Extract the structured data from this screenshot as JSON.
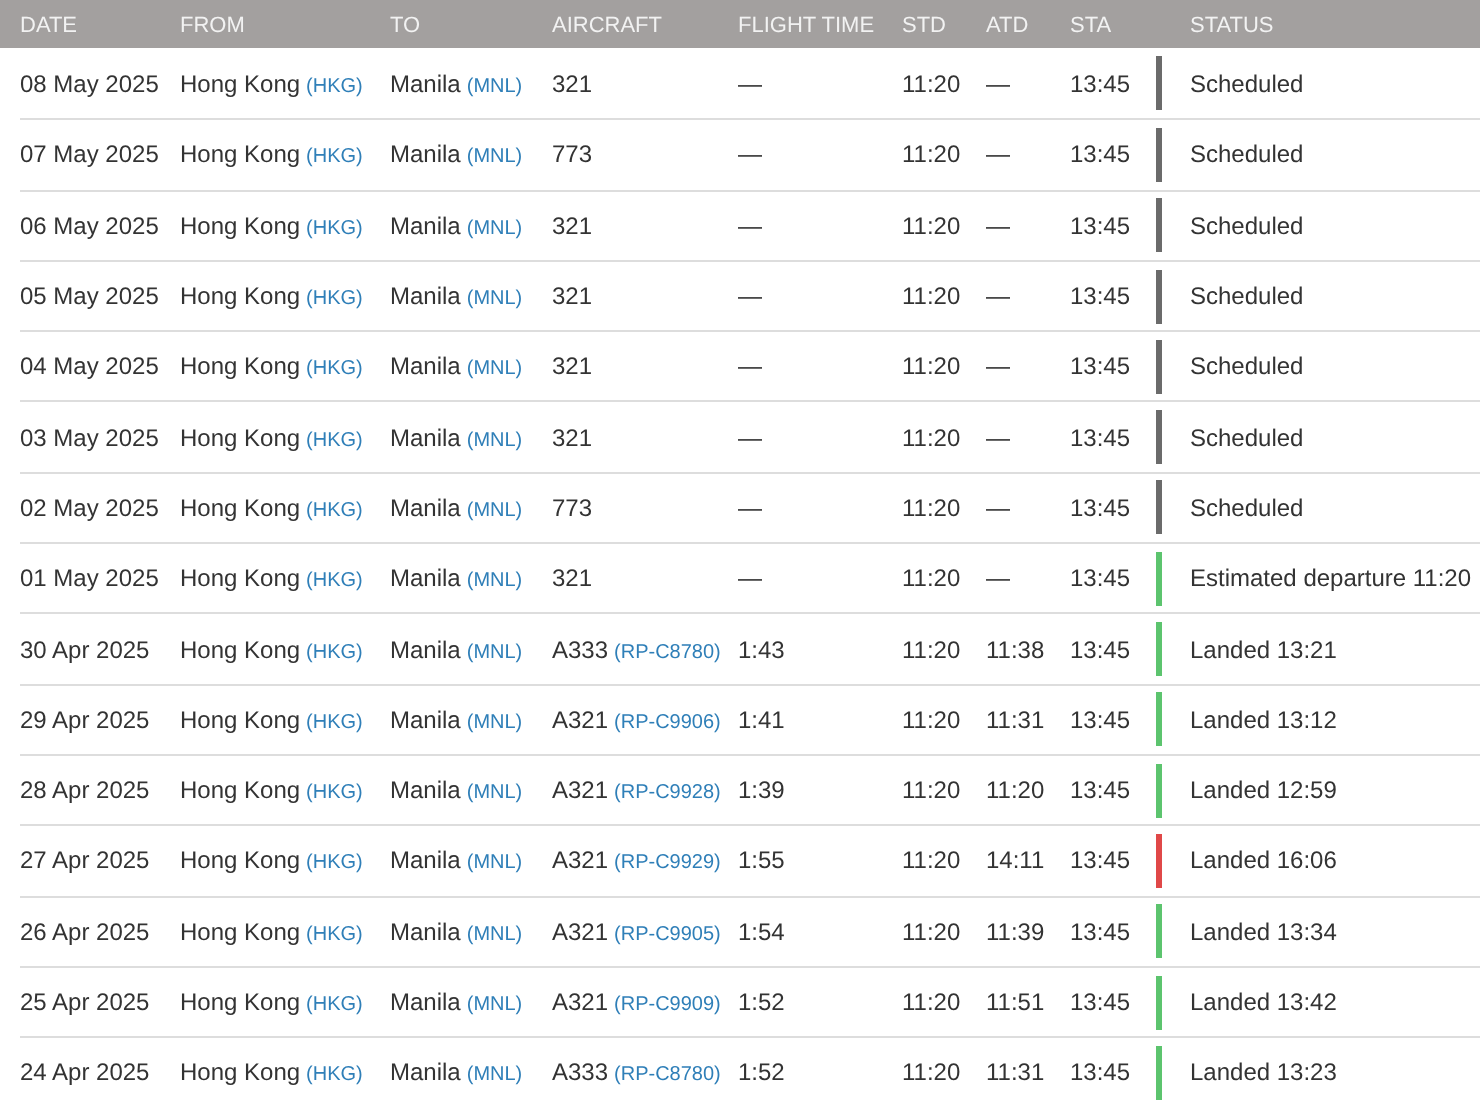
{
  "columns": [
    "DATE",
    "FROM",
    "TO",
    "AIRCRAFT",
    "FLIGHT TIME",
    "STD",
    "ATD",
    "STA",
    "STATUS"
  ],
  "rows": [
    {
      "date": "08 May 2025",
      "from": "Hong Kong",
      "from_code": "(HKG)",
      "to": "Manila",
      "to_code": "(MNL)",
      "aircraft": "321",
      "flight_time": "—",
      "std": "11:20",
      "atd": "—",
      "sta": "13:45",
      "status": "Scheduled",
      "color": "#6b6b6b"
    },
    {
      "date": "07 May 2025",
      "from": "Hong Kong",
      "from_code": "(HKG)",
      "to": "Manila",
      "to_code": "(MNL)",
      "aircraft": "773",
      "flight_time": "—",
      "std": "11:20",
      "atd": "—",
      "sta": "13:45",
      "status": "Scheduled",
      "color": "#6b6b6b"
    },
    {
      "date": "06 May 2025",
      "from": "Hong Kong",
      "from_code": "(HKG)",
      "to": "Manila",
      "to_code": "(MNL)",
      "aircraft": "321",
      "flight_time": "—",
      "std": "11:20",
      "atd": "—",
      "sta": "13:45",
      "status": "Scheduled",
      "color": "#6b6b6b"
    },
    {
      "date": "05 May 2025",
      "from": "Hong Kong",
      "from_code": "(HKG)",
      "to": "Manila",
      "to_code": "(MNL)",
      "aircraft": "321",
      "flight_time": "—",
      "std": "11:20",
      "atd": "—",
      "sta": "13:45",
      "status": "Scheduled",
      "color": "#6b6b6b"
    },
    {
      "date": "04 May 2025",
      "from": "Hong Kong",
      "from_code": "(HKG)",
      "to": "Manila",
      "to_code": "(MNL)",
      "aircraft": "321",
      "flight_time": "—",
      "std": "11:20",
      "atd": "—",
      "sta": "13:45",
      "status": "Scheduled",
      "color": "#6b6b6b"
    },
    {
      "date": "03 May 2025",
      "from": "Hong Kong",
      "from_code": "(HKG)",
      "to": "Manila",
      "to_code": "(MNL)",
      "aircraft": "321",
      "flight_time": "—",
      "std": "11:20",
      "atd": "—",
      "sta": "13:45",
      "status": "Scheduled",
      "color": "#6b6b6b"
    },
    {
      "date": "02 May 2025",
      "from": "Hong Kong",
      "from_code": "(HKG)",
      "to": "Manila",
      "to_code": "(MNL)",
      "aircraft": "773",
      "flight_time": "—",
      "std": "11:20",
      "atd": "—",
      "sta": "13:45",
      "status": "Scheduled",
      "color": "#6b6b6b"
    },
    {
      "date": "01 May 2025",
      "from": "Hong Kong",
      "from_code": "(HKG)",
      "to": "Manila",
      "to_code": "(MNL)",
      "aircraft": "321",
      "flight_time": "—",
      "std": "11:20",
      "atd": "—",
      "sta": "13:45",
      "status": "Estimated departure 11:20",
      "color": "#5cc46e"
    },
    {
      "date": "30 Apr 2025",
      "from": "Hong Kong",
      "from_code": "(HKG)",
      "to": "Manila",
      "to_code": "(MNL)",
      "aircraft": "A333",
      "registration": "(RP-C8780)",
      "flight_time": "1:43",
      "std": "11:20",
      "atd": "11:38",
      "sta": "13:45",
      "status": "Landed 13:21",
      "color": "#5cc46e"
    },
    {
      "date": "29 Apr 2025",
      "from": "Hong Kong",
      "from_code": "(HKG)",
      "to": "Manila",
      "to_code": "(MNL)",
      "aircraft": "A321",
      "registration": "(RP-C9906)",
      "flight_time": "1:41",
      "std": "11:20",
      "atd": "11:31",
      "sta": "13:45",
      "status": "Landed 13:12",
      "color": "#5cc46e"
    },
    {
      "date": "28 Apr 2025",
      "from": "Hong Kong",
      "from_code": "(HKG)",
      "to": "Manila",
      "to_code": "(MNL)",
      "aircraft": "A321",
      "registration": "(RP-C9928)",
      "flight_time": "1:39",
      "std": "11:20",
      "atd": "11:20",
      "sta": "13:45",
      "status": "Landed 12:59",
      "color": "#5cc46e"
    },
    {
      "date": "27 Apr 2025",
      "from": "Hong Kong",
      "from_code": "(HKG)",
      "to": "Manila",
      "to_code": "(MNL)",
      "aircraft": "A321",
      "registration": "(RP-C9929)",
      "flight_time": "1:55",
      "std": "11:20",
      "atd": "14:11",
      "sta": "13:45",
      "status": "Landed 16:06",
      "color": "#e04848"
    },
    {
      "date": "26 Apr 2025",
      "from": "Hong Kong",
      "from_code": "(HKG)",
      "to": "Manila",
      "to_code": "(MNL)",
      "aircraft": "A321",
      "registration": "(RP-C9905)",
      "flight_time": "1:54",
      "std": "11:20",
      "atd": "11:39",
      "sta": "13:45",
      "status": "Landed 13:34",
      "color": "#5cc46e"
    },
    {
      "date": "25 Apr 2025",
      "from": "Hong Kong",
      "from_code": "(HKG)",
      "to": "Manila",
      "to_code": "(MNL)",
      "aircraft": "A321",
      "registration": "(RP-C9909)",
      "flight_time": "1:52",
      "std": "11:20",
      "atd": "11:51",
      "sta": "13:45",
      "status": "Landed 13:42",
      "color": "#5cc46e"
    },
    {
      "date": "24 Apr 2025",
      "from": "Hong Kong",
      "from_code": "(HKG)",
      "to": "Manila",
      "to_code": "(MNL)",
      "aircraft": "A333",
      "registration": "(RP-C8780)",
      "flight_time": "1:52",
      "std": "11:20",
      "atd": "11:31",
      "sta": "13:45",
      "status": "Landed 13:23",
      "color": "#5cc46e"
    }
  ]
}
